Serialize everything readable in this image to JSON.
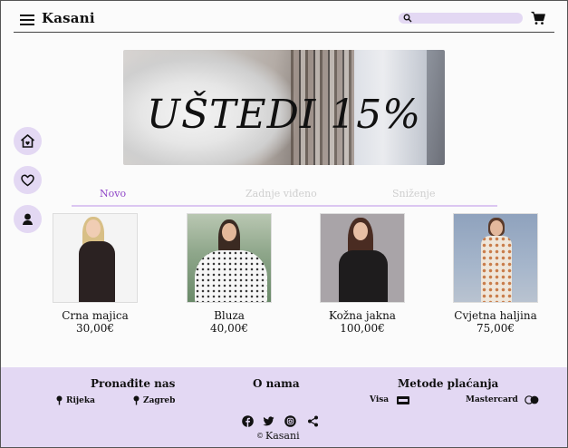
{
  "header": {
    "brand": "Kasani",
    "search_placeholder": "",
    "icons": [
      "menu-icon",
      "search-icon",
      "cart-icon"
    ]
  },
  "hero": {
    "text": "UŠTEDI 15%"
  },
  "side_nav": {
    "icons": [
      "home-icon",
      "heart-icon",
      "profile-icon"
    ]
  },
  "tabs": [
    {
      "label": "Novo",
      "active": true
    },
    {
      "label": "Zadnje viđeno",
      "active": false
    },
    {
      "label": "Sniženje",
      "active": false
    }
  ],
  "products": [
    {
      "name": "Crna majica",
      "price": "30,00€"
    },
    {
      "name": "Bluza",
      "price": "40,00€"
    },
    {
      "name": "Kožna jakna",
      "price": "100,00€"
    },
    {
      "name": "Cvjetna haljina",
      "price": "75,00€"
    }
  ],
  "footer": {
    "find_us": {
      "title": "Pronađite nas",
      "locations": [
        "Rijeka",
        "Zagreb"
      ]
    },
    "about": {
      "title": "O nama"
    },
    "payment": {
      "title": "Metode plaćanja",
      "methods": [
        "Visa",
        "Mastercard"
      ]
    },
    "social_icons": [
      "facebook-icon",
      "twitter-icon",
      "instagram-icon",
      "share-icon"
    ],
    "copyright": "Kasani"
  },
  "colors": {
    "accent_lilac": "#e3d8f3",
    "active_tab": "#8e44c7",
    "tab_underline": "#dbc6f1"
  }
}
